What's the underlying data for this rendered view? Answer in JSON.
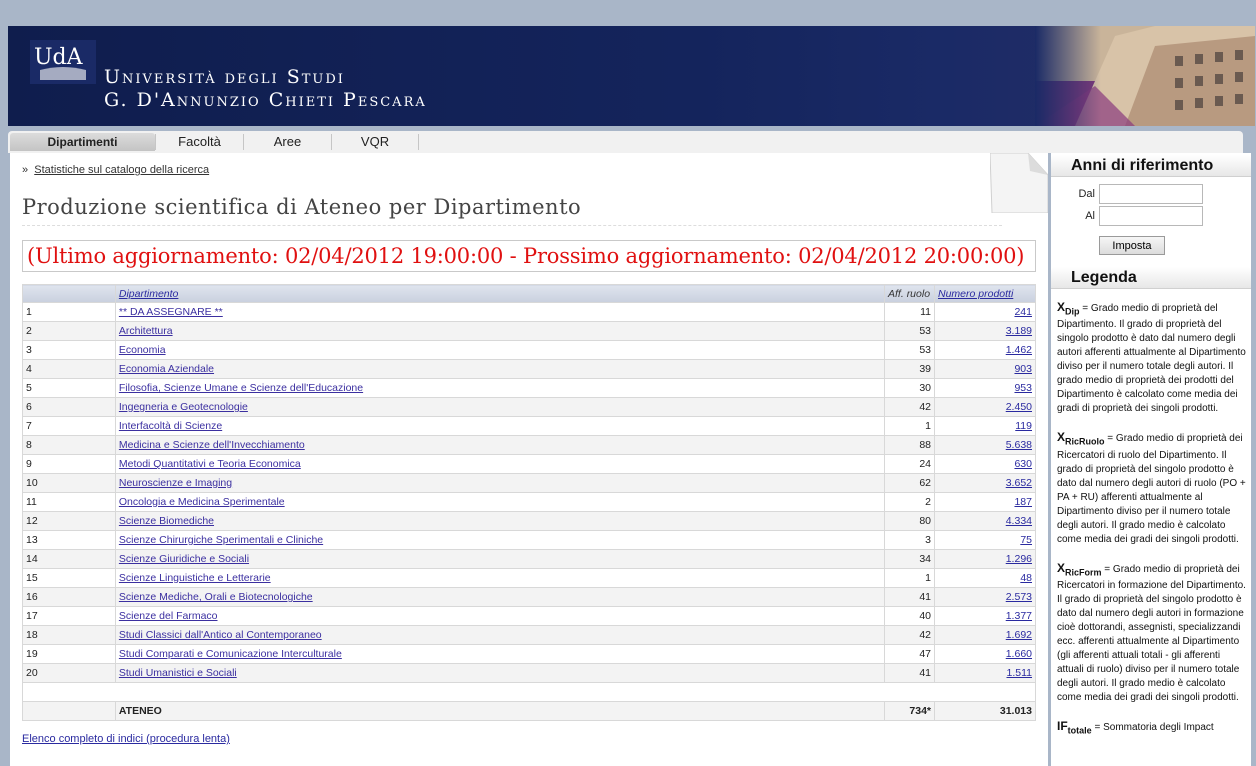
{
  "header": {
    "logo_text": "UdA",
    "university_line1": "Università degli Studi",
    "university_line2": "G. D'Annunzio Chieti Pescara"
  },
  "tabs": [
    {
      "label": "Dipartimenti",
      "active": true
    },
    {
      "label": "Facoltà",
      "active": false
    },
    {
      "label": "Aree",
      "active": false
    },
    {
      "label": "VQR",
      "active": false
    }
  ],
  "breadcrumb": {
    "sep": "»",
    "link": "Statistiche sul catalogo della ricerca"
  },
  "page_title": "Produzione scientifica di Ateneo per Dipartimento",
  "update_notice": "(Ultimo aggiornamento: 02/04/2012 19:00:00 - Prossimo aggiornamento: 02/04/2012 20:00:00)",
  "table": {
    "headers": {
      "dept": "Dipartimento",
      "aff": "Aff. ruolo",
      "prod": "Numero prodotti"
    },
    "rows": [
      {
        "n": "1",
        "dept": "** DA ASSEGNARE **",
        "aff": "11",
        "prod": "241"
      },
      {
        "n": "2",
        "dept": "Architettura",
        "aff": "53",
        "prod": "3.189"
      },
      {
        "n": "3",
        "dept": "Economia",
        "aff": "53",
        "prod": "1.462"
      },
      {
        "n": "4",
        "dept": "Economia Aziendale",
        "aff": "39",
        "prod": "903"
      },
      {
        "n": "5",
        "dept": "Filosofia, Scienze Umane e Scienze dell'Educazione",
        "aff": "30",
        "prod": "953"
      },
      {
        "n": "6",
        "dept": "Ingegneria e Geotecnologie",
        "aff": "42",
        "prod": "2.450"
      },
      {
        "n": "7",
        "dept": "Interfacoltà di Scienze",
        "aff": "1",
        "prod": "119"
      },
      {
        "n": "8",
        "dept": "Medicina e Scienze dell'Invecchiamento",
        "aff": "88",
        "prod": "5.638"
      },
      {
        "n": "9",
        "dept": "Metodi Quantitativi e Teoria Economica",
        "aff": "24",
        "prod": "630"
      },
      {
        "n": "10",
        "dept": "Neuroscienze e Imaging",
        "aff": "62",
        "prod": "3.652"
      },
      {
        "n": "11",
        "dept": "Oncologia e Medicina Sperimentale",
        "aff": "2",
        "prod": "187"
      },
      {
        "n": "12",
        "dept": "Scienze Biomediche",
        "aff": "80",
        "prod": "4.334"
      },
      {
        "n": "13",
        "dept": "Scienze Chirurgiche Sperimentali e Cliniche",
        "aff": "3",
        "prod": "75"
      },
      {
        "n": "14",
        "dept": "Scienze Giuridiche e Sociali",
        "aff": "34",
        "prod": "1.296"
      },
      {
        "n": "15",
        "dept": "Scienze Linguistiche e Letterarie",
        "aff": "1",
        "prod": "48"
      },
      {
        "n": "16",
        "dept": "Scienze Mediche, Orali e Biotecnologiche",
        "aff": "41",
        "prod": "2.573"
      },
      {
        "n": "17",
        "dept": "Scienze del Farmaco",
        "aff": "40",
        "prod": "1.377"
      },
      {
        "n": "18",
        "dept": "Studi Classici dall'Antico al Contemporaneo",
        "aff": "42",
        "prod": "1.692"
      },
      {
        "n": "19",
        "dept": "Studi Comparati e Comunicazione Interculturale",
        "aff": "47",
        "prod": "1.660"
      },
      {
        "n": "20",
        "dept": "Studi Umanistici e Sociali",
        "aff": "41",
        "prod": "1.511"
      }
    ],
    "total": {
      "label": "ATENEO",
      "aff": "734*",
      "prod": "31.013"
    }
  },
  "full_index_link": "Elenco completo di indici (procedura lenta)",
  "sidebar": {
    "years_title": "Anni di riferimento",
    "from_label": "Dal",
    "to_label": "Al",
    "from_value": "",
    "to_value": "",
    "set_button": "Imposta",
    "legend_title": "Legenda",
    "legend": [
      {
        "sym": "X",
        "sub": "Dip",
        "text": " = Grado medio di proprietà del Dipartimento. Il grado di proprietà del singolo prodotto è dato dal numero degli autori afferenti attualmente al Dipartimento diviso per il numero totale degli autori. Il grado medio di proprietà dei prodotti del Dipartimento è calcolato come media dei gradi di proprietà dei singoli prodotti."
      },
      {
        "sym": "X",
        "sub": "RicRuolo",
        "text": " = Grado medio di proprietà dei Ricercatori di ruolo del Dipartimento. Il grado di proprietà del singolo prodotto è dato dal numero degli autori di ruolo (PO + PA + RU) afferenti attualmente al Dipartimento diviso per il numero totale degli autori. Il grado medio è calcolato come media dei gradi dei singoli prodotti."
      },
      {
        "sym": "X",
        "sub": "RicForm",
        "text": " = Grado medio di proprietà dei Ricercatori in formazione del Dipartimento. Il grado di proprietà del singolo prodotto è dato dal numero degli autori in formazione cioè dottorandi, assegnisti, specializzandi ecc. afferenti attualmente al Dipartimento (gli afferenti attuali totali - gli afferenti attuali di ruolo) diviso per il numero totale degli autori. Il grado medio è calcolato come media dei gradi dei singoli prodotti."
      },
      {
        "sym": "IF",
        "sub": "totale",
        "text": " = Sommatoria degli Impact"
      }
    ]
  },
  "colors": {
    "banner": "#14245c",
    "update_red": "#e01010",
    "link": "#3b2fa0",
    "page_bg": "#a9b6c8"
  }
}
